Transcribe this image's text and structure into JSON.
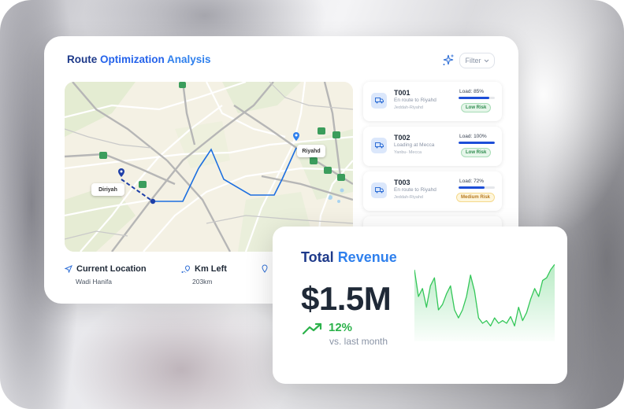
{
  "card": {
    "title_part1": "Route",
    "title_part2": "Optimization",
    "title_part3": "Analysis",
    "filter_label": "Filter",
    "icons": {
      "sparkle": "sparkle-icon",
      "chevron": "chevron-down-icon"
    }
  },
  "map": {
    "origin_label": "Diriyah",
    "destination_label": "Riyahd"
  },
  "trucks": [
    {
      "id": "T001",
      "status": "En route to Riyahd",
      "route": "Jeddah-Riyahd",
      "load_label": "Load: 85%",
      "load": 0.85,
      "risk": "Low Risk",
      "risk_level": "low"
    },
    {
      "id": "T002",
      "status": "Loading at Mecca",
      "route": "Yanbu- Mecca",
      "load_label": "Load: 100%",
      "load": 1.0,
      "risk": "Low Risk",
      "risk_level": "low"
    },
    {
      "id": "T003",
      "status": "En route to Riyahd",
      "route": "Jeddah-Riyahd",
      "load_label": "Load: 72%",
      "load": 0.72,
      "risk": "Medium Risk",
      "risk_level": "medium"
    }
  ],
  "stats": {
    "current_location_label": "Current Location",
    "current_location_value": "Wadi Hanifa",
    "km_left_label": "Km Left",
    "km_left_value": "203km"
  },
  "revenue": {
    "title_part1": "Total",
    "title_part2": "Revenue",
    "amount": "$1.5M",
    "change": "12%",
    "change_sub": "vs. last month",
    "colors": {
      "line": "#34c759",
      "positive": "#2bb24a"
    },
    "trend": [
      10,
      30,
      24,
      38,
      22,
      16,
      40,
      36,
      28,
      22,
      40,
      46,
      40,
      30,
      14,
      26,
      46,
      50,
      48,
      52,
      46,
      50,
      48,
      50,
      45,
      52,
      38,
      48,
      42,
      32,
      24,
      30,
      18,
      16,
      10,
      6
    ]
  },
  "colors": {
    "accent": "#1d4ed8",
    "route_line": "#1c6fe0"
  }
}
